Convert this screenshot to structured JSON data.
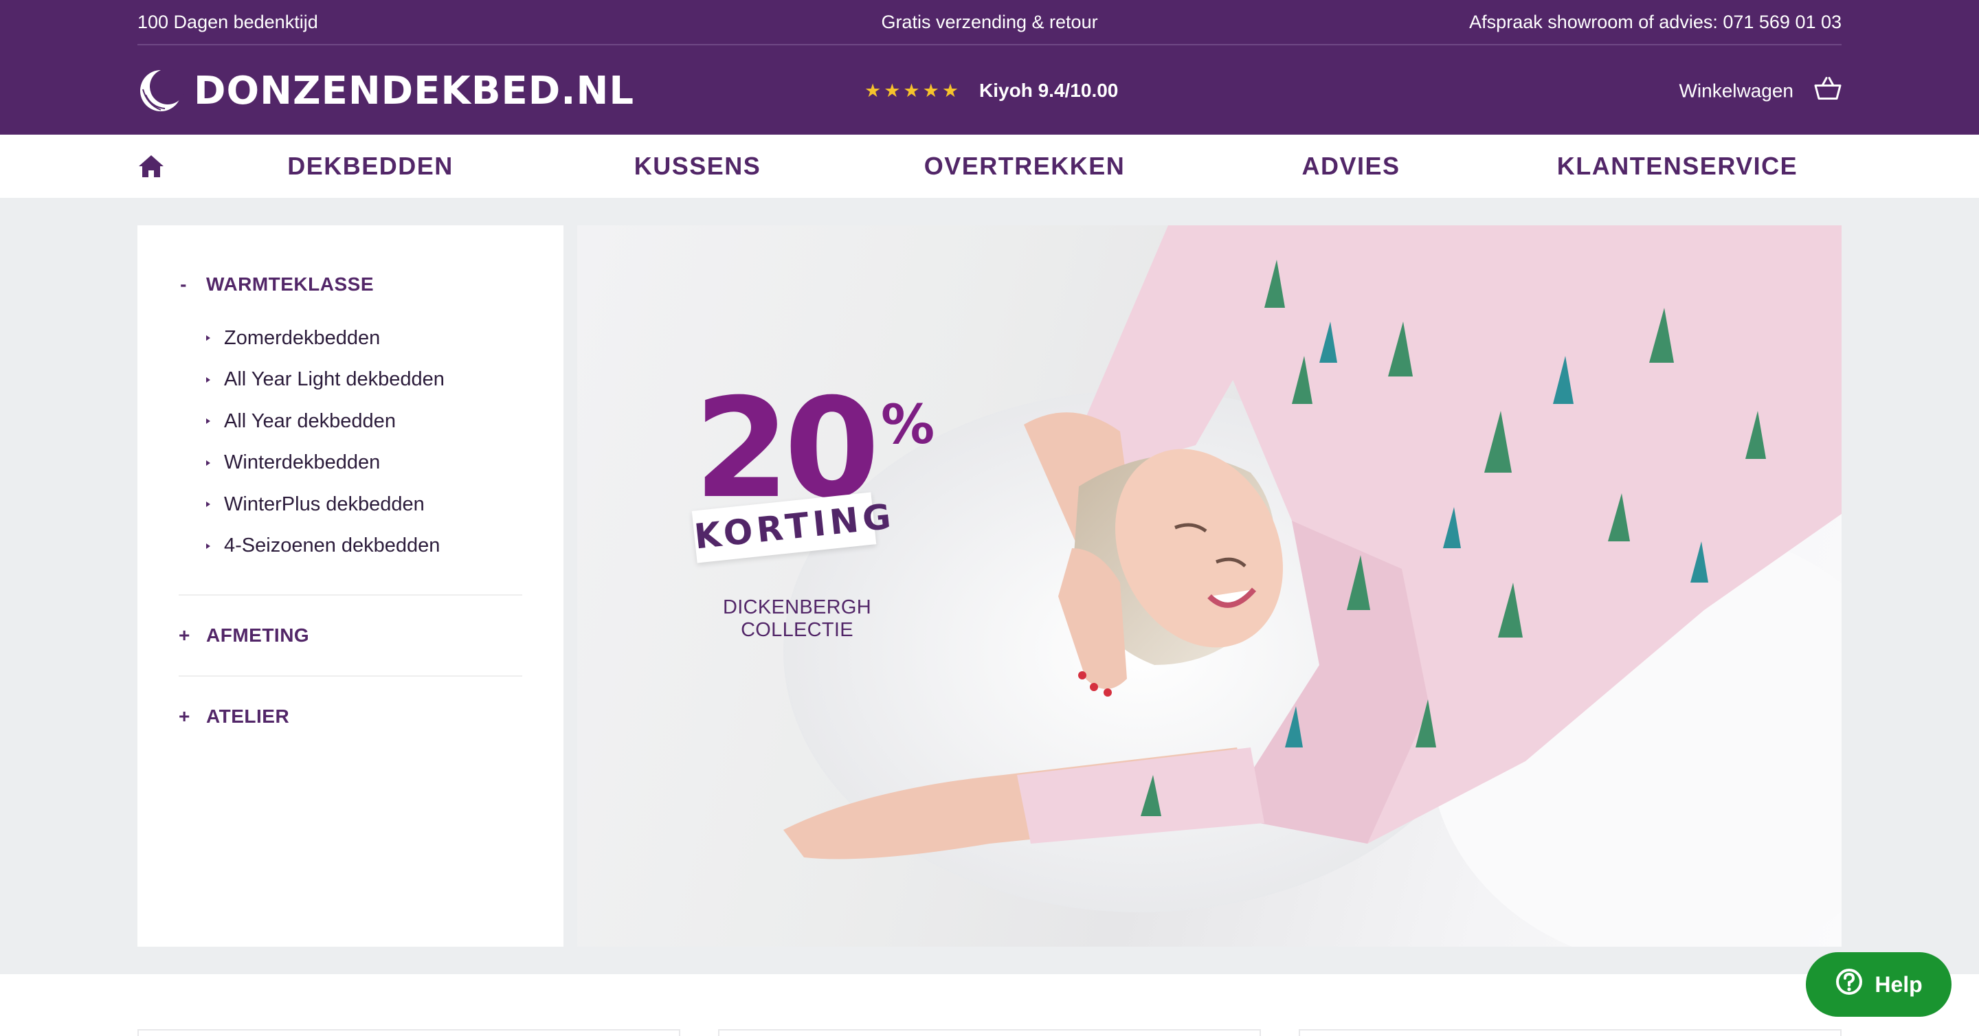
{
  "usp": {
    "left": "100 Dagen bedenktijd",
    "center": "Gratis verzending & retour",
    "right": "Afspraak showroom of advies: 071 569 01 03"
  },
  "brand": {
    "name": "DONZENDEKBED.NL",
    "logo_icon": "crescent-moon-icon"
  },
  "rating": {
    "stars": "★★★★★",
    "label": "Kiyoh 9.4/10.00",
    "star_color": "#f6c32c"
  },
  "cart": {
    "label": "Winkelwagen",
    "icon": "basket-icon"
  },
  "nav": {
    "home_icon": "home-icon",
    "items": [
      {
        "label": "DEKBEDDEN"
      },
      {
        "label": "KUSSENS"
      },
      {
        "label": "OVERTREKKEN"
      },
      {
        "label": "ADVIES"
      },
      {
        "label": "KLANTENSERVICE"
      }
    ]
  },
  "sidebar": {
    "groups": [
      {
        "sign": "-",
        "title": "WARMTEKLASSE",
        "expanded": true,
        "items": [
          {
            "label": "Zomerdekbedden"
          },
          {
            "label": "All Year Light dekbedden"
          },
          {
            "label": "All Year dekbedden"
          },
          {
            "label": "Winterdekbedden"
          },
          {
            "label": "WinterPlus dekbedden"
          },
          {
            "label": "4-Seizoenen dekbedden"
          }
        ]
      },
      {
        "sign": "+",
        "title": "AFMETING",
        "expanded": false
      },
      {
        "sign": "+",
        "title": "ATELIER",
        "expanded": false
      }
    ]
  },
  "hero": {
    "percent_value": "20",
    "percent_sign": "%",
    "tag": "KORTING",
    "subtitle": "DICKENBERGH COLLECTIE"
  },
  "help": {
    "label": "Help",
    "icon": "question-circle-icon"
  },
  "colors": {
    "brand_purple": "#522668",
    "promo_purple": "#7d1e83",
    "help_green": "#1a9430",
    "page_bg": "#eceef0"
  }
}
